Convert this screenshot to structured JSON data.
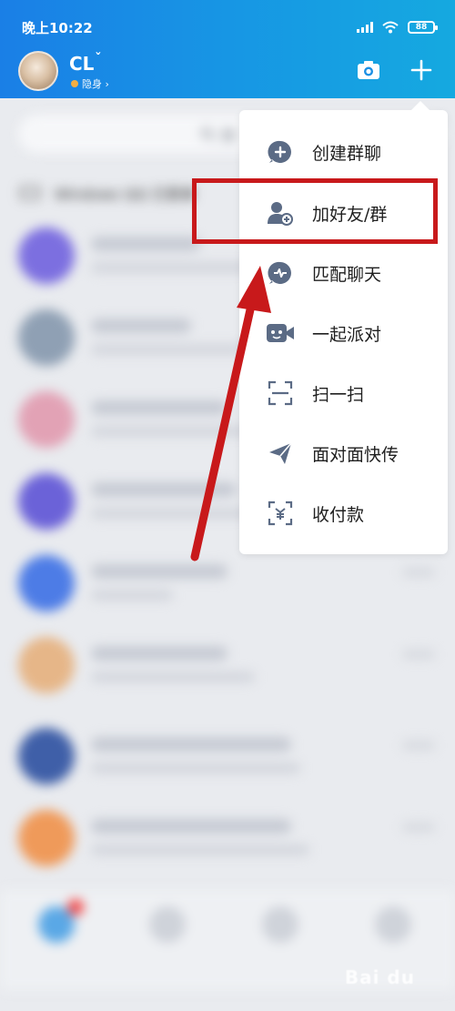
{
  "status_bar": {
    "time": "晚上10:22",
    "battery": "88"
  },
  "header": {
    "username": "CL",
    "username_suffix": "ˇ",
    "presence": "隐身 ›"
  },
  "search": {
    "placeholder": "搜"
  },
  "pc_login": {
    "text": "Windows QQ 已登录"
  },
  "menu": {
    "items": [
      {
        "label": "创建群聊",
        "icon": "group-add-icon"
      },
      {
        "label": "加好友/群",
        "icon": "add-friend-icon"
      },
      {
        "label": "匹配聊天",
        "icon": "match-chat-icon"
      },
      {
        "label": "一起派对",
        "icon": "party-icon"
      },
      {
        "label": "扫一扫",
        "icon": "scan-icon"
      },
      {
        "label": "面对面快传",
        "icon": "send-icon"
      },
      {
        "label": "收付款",
        "icon": "payment-icon"
      }
    ]
  },
  "watermark": "Bai du",
  "colors": {
    "header_start": "#1a7fe6",
    "header_end": "#15a9e0",
    "highlight": "#c8191b",
    "menu_icon": "#5b6b85"
  }
}
